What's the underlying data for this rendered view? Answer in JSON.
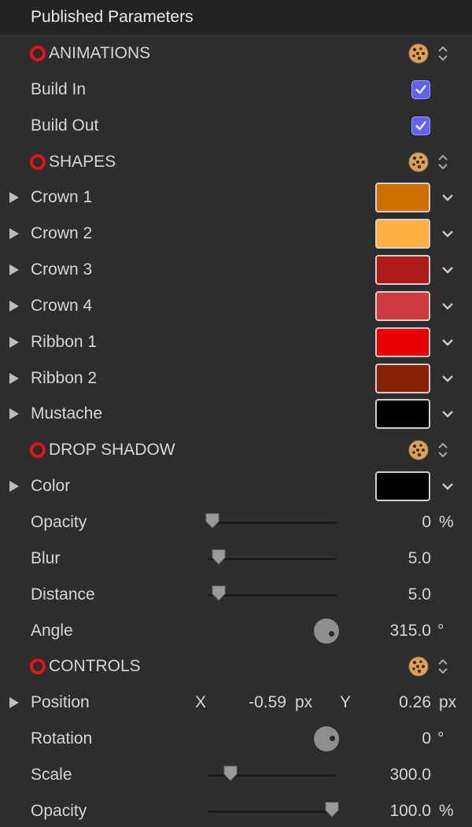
{
  "header": {
    "title": "Published Parameters"
  },
  "sections": {
    "animations": {
      "label": "ANIMATIONS"
    },
    "shapes": {
      "label": "SHAPES"
    },
    "drop_shadow": {
      "label": "DROP SHADOW"
    },
    "controls": {
      "label": "CONTROLS"
    }
  },
  "animations": {
    "build_in": {
      "label": "Build In",
      "checked": true
    },
    "build_out": {
      "label": "Build Out",
      "checked": true
    }
  },
  "shapes": [
    {
      "label": "Crown 1",
      "color": "#d07000"
    },
    {
      "label": "Crown 2",
      "color": "#ffb03e"
    },
    {
      "label": "Crown 3",
      "color": "#b0191b"
    },
    {
      "label": "Crown 4",
      "color": "#d03a3e"
    },
    {
      "label": "Ribbon 1",
      "color": "#e80000"
    },
    {
      "label": "Ribbon 2",
      "color": "#892200"
    },
    {
      "label": "Mustache",
      "color": "#000000"
    }
  ],
  "drop_shadow": {
    "color": {
      "label": "Color",
      "color": "#000000"
    },
    "opacity": {
      "label": "Opacity",
      "value": "0",
      "unit": "%",
      "slider_fraction": 0.0
    },
    "blur": {
      "label": "Blur",
      "value": "5.0",
      "slider_fraction": 0.05
    },
    "distance": {
      "label": "Distance",
      "value": "5.0",
      "slider_fraction": 0.05
    },
    "angle": {
      "label": "Angle",
      "value": "315.0",
      "unit": "°"
    }
  },
  "controls": {
    "position": {
      "label": "Position",
      "x_label": "X",
      "x_value": "-0.59",
      "x_unit": "px",
      "y_label": "Y",
      "y_value": "0.26",
      "y_unit": "px"
    },
    "rotation": {
      "label": "Rotation",
      "value": "0",
      "unit": "°"
    },
    "scale": {
      "label": "Scale",
      "value": "300.0",
      "slider_fraction": 0.15
    },
    "opacity": {
      "label": "Opacity",
      "value": "100.0",
      "unit": "%",
      "slider_fraction": 1.0
    }
  },
  "icons": {
    "section_marker": "red-circle-icon",
    "preset": "cookie-icon",
    "expand": "disclosure-triangle-icon",
    "menu": "chevron-down-icon",
    "stepper": "up-down-stepper-icon"
  }
}
